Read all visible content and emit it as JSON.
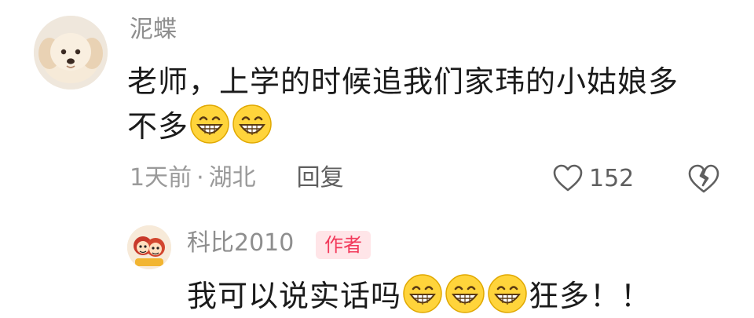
{
  "comment": {
    "username": "泥蝶",
    "text_line1": "老师，上学的时候追我们家玮的小姑娘多",
    "text_line2_before_emoji": "不多",
    "emoji_icon": "grinning-face-icon",
    "time": "1天前",
    "separator": "·",
    "location": "湖北",
    "reply_label": "回复",
    "like_count": "152",
    "like_icon": "heart-outline-icon",
    "dislike_icon": "broken-heart-icon"
  },
  "reply": {
    "username": "科比2010",
    "badge": "作者",
    "text_before_emoji": "我可以说实话吗",
    "text_after_emoji": "狂多！！"
  },
  "colors": {
    "username": "#8e8e8e",
    "text": "#1b1b1b",
    "meta": "#9a9a9a",
    "badge_bg": "#ffe5e8",
    "badge_text": "#f23a5b"
  }
}
